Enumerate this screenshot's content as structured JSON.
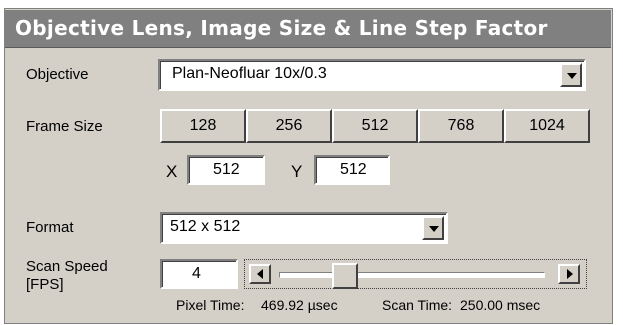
{
  "title": "Objective Lens, Image Size & Line Step Factor",
  "objective": {
    "label": "Objective",
    "value": "Plan-Neofluar 10x/0.3"
  },
  "frame_size": {
    "label": "Frame Size",
    "buttons": [
      "128",
      "256",
      "512",
      "768",
      "1024"
    ],
    "x_label": "X",
    "x_value": "512",
    "y_label": "Y",
    "y_value": "512"
  },
  "format": {
    "label": "Format",
    "value": "512 x 512"
  },
  "scan_speed": {
    "label_line1": "Scan Speed",
    "label_line2": "[FPS]",
    "value": "4",
    "slider_position": 0.22,
    "pixel_time_label": "Pixel Time:",
    "pixel_time_value": "469.92 µsec",
    "scan_time_label": "Scan Time:",
    "scan_time_value": "250.00 msec"
  },
  "icons": {
    "dropdown": "chevron-down-icon",
    "left": "arrow-left-icon",
    "right": "arrow-right-icon"
  }
}
